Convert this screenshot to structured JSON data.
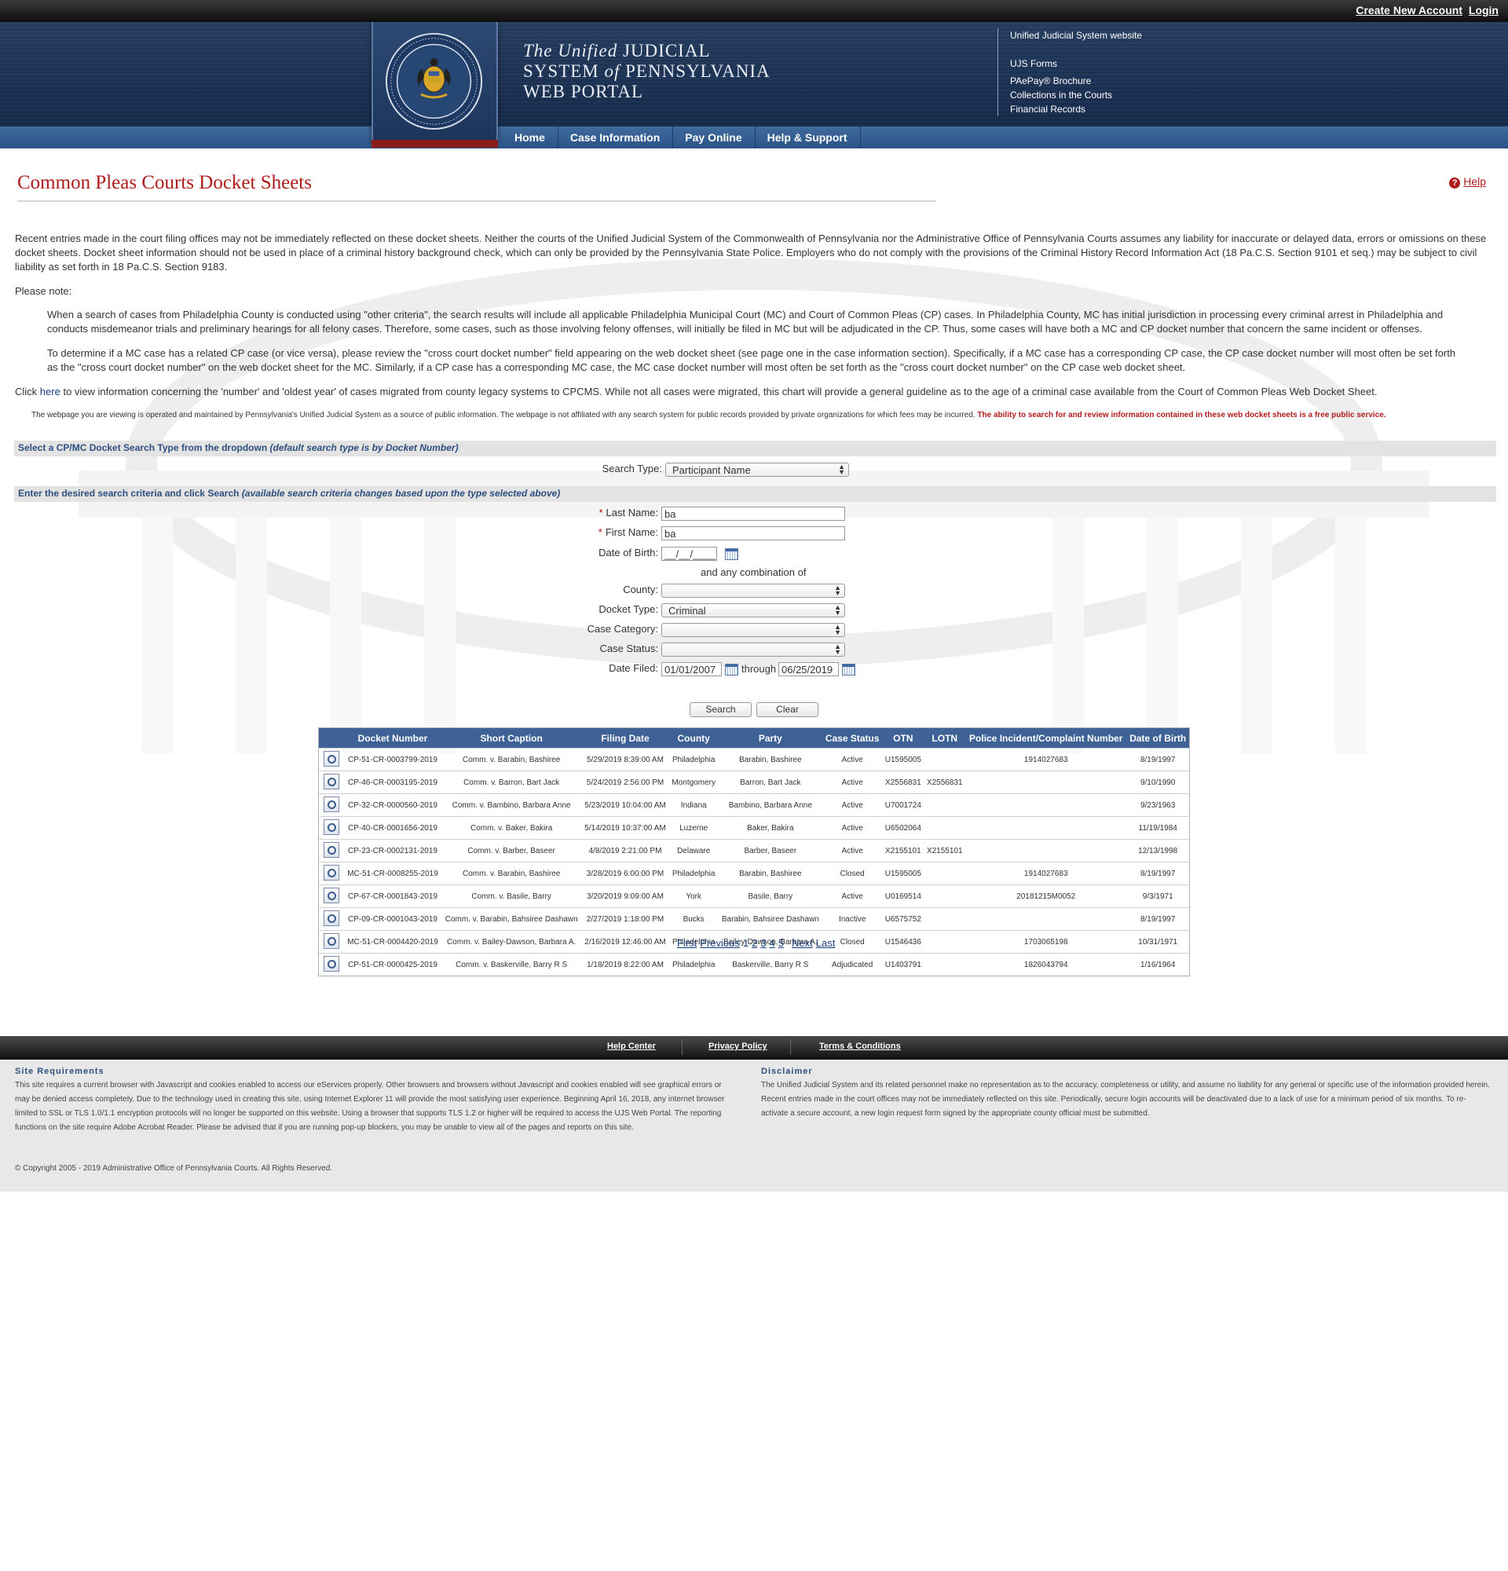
{
  "topbar": {
    "create_account": "Create New Account",
    "login": "Login"
  },
  "header": {
    "title_line1_a": "The Unified",
    "title_line1_b": "JUDICIAL",
    "title_line2_a": "SYSTEM",
    "title_line2_b": "of",
    "title_line2_c": "PENNSYLVANIA",
    "title_line3": "WEB PORTAL",
    "links": [
      "Unified Judicial System website",
      "UJS Forms",
      "PAePay® Brochure",
      "Collections in the Courts",
      "Financial Records"
    ]
  },
  "nav": [
    "Home",
    "Case Information",
    "Pay Online",
    "Help & Support"
  ],
  "page": {
    "title": "Common Pleas Courts Docket Sheets",
    "help": "Help",
    "disclaimer": "Recent entries made in the court filing offices may not be immediately reflected on these docket sheets. Neither the courts of the Unified Judicial System of the Commonwealth of Pennsylvania nor the Administrative Office of Pennsylvania Courts assumes any liability for inaccurate or delayed data, errors or omissions on these docket sheets. Docket sheet information should not be used in place of a criminal history background check, which can only be provided by the Pennsylvania State Police. Employers who do not comply with the provisions of the Criminal History Record Information Act (18 Pa.C.S. Section 9101 et seq.) may be subject to civil liability as set forth in 18 Pa.C.S. Section 9183.",
    "please_note": "Please note:",
    "note1": "When a search of cases from Philadelphia County is conducted using \"other criteria\", the search results will include all applicable Philadelphia Municipal Court (MC) and Court of Common Pleas (CP) cases. In Philadelphia County, MC has initial jurisdiction in processing every criminal arrest in Philadelphia and conducts misdemeanor trials and preliminary hearings for all felony cases. Therefore, some cases, such as those involving felony offenses, will initially be filed in MC but will be adjudicated in the CP. Thus, some cases will have both a MC and CP docket number that concern the same incident or offenses.",
    "note2": "To determine if a MC case has a related CP case (or vice versa), please review the \"cross court docket number\" field appearing on the web docket sheet (see page one in the case information section). Specifically, if a MC case has a corresponding CP case, the CP case docket number will most often be set forth as the \"cross court docket number\" on the web docket sheet for the MC. Similarly, if a CP case has a corresponding MC case, the MC case docket number will most often be set forth as the \"cross court docket number\" on the CP case web docket sheet.",
    "click_prefix": "Click",
    "click_link": "here",
    "click_suffix": "to view information concerning the 'number' and 'oldest year' of cases migrated from county legacy systems to CPCMS. While not all cases were migrated, this chart will provide a general guideline as to the age of a criminal case available from the Court of Common Pleas Web Docket Sheet.",
    "small_note": "The webpage you are viewing is operated and maintained by Pennsylvania's Unified Judicial System as a source of public information. The webpage is not affiliated with any search system for public records provided by private organizations for which fees may be incurred.",
    "small_note_red": "The ability to search for and review information contained in these web docket sheets is a free public service."
  },
  "search": {
    "section1": "Select a CP/MC Docket Search Type from the dropdown",
    "section1_note": "(default search type is by Docket Number)",
    "search_type_label": "Search Type:",
    "search_type_value": "Participant Name",
    "section2": "Enter the desired search criteria and click Search",
    "section2_note": "(available search criteria changes based upon the type selected above)",
    "last_name_label": "Last Name:",
    "last_name_value": "ba",
    "first_name_label": "First Name:",
    "first_name_value": "ba",
    "dob_label": "Date of Birth:",
    "dob_value": "__/__/____",
    "combination": "and any combination of",
    "county_label": "County:",
    "county_value": "",
    "docket_type_label": "Docket Type:",
    "docket_type_value": "Criminal",
    "case_category_label": "Case Category:",
    "case_category_value": "",
    "case_status_label": "Case Status:",
    "case_status_value": "",
    "date_filed_label": "Date Filed:",
    "date_from": "01/01/2007",
    "through": "through",
    "date_to": "06/25/2019",
    "search_btn": "Search",
    "clear_btn": "Clear"
  },
  "results": {
    "columns": [
      "",
      "Docket Number",
      "Short Caption",
      "Filing Date",
      "County",
      "Party",
      "Case Status",
      "OTN",
      "LOTN",
      "Police Incident/Complaint Number",
      "Date of Birth"
    ],
    "rows": [
      [
        "CP-51-CR-0003799-2019",
        "Comm. v. Barabin, Bashiree",
        "5/29/2019 8:39:00 AM",
        "Philadelphia",
        "Barabin, Bashiree",
        "Active",
        "U1595005",
        "",
        "1914027683",
        "8/19/1997"
      ],
      [
        "CP-46-CR-0003195-2019",
        "Comm. v. Barron, Bart Jack",
        "5/24/2019 2:56:00 PM",
        "Montgomery",
        "Barron, Bart Jack",
        "Active",
        "X2556831",
        "X2556831",
        "",
        "9/10/1990"
      ],
      [
        "CP-32-CR-0000560-2019",
        "Comm. v. Bambino, Barbara Anne",
        "5/23/2019 10:04:00 AM",
        "Indiana",
        "Bambino, Barbara Anne",
        "Active",
        "U7001724",
        "",
        "",
        "9/23/1963"
      ],
      [
        "CP-40-CR-0001656-2019",
        "Comm. v. Baker, Bakira",
        "5/14/2019 10:37:00 AM",
        "Luzerne",
        "Baker, Bakira",
        "Active",
        "U6502064",
        "",
        "",
        "11/19/1984"
      ],
      [
        "CP-23-CR-0002131-2019",
        "Comm. v. Barber, Baseer",
        "4/8/2019 2:21:00 PM",
        "Delaware",
        "Barber, Baseer",
        "Active",
        "X2155101",
        "X2155101",
        "",
        "12/13/1998"
      ],
      [
        "MC-51-CR-0008255-2019",
        "Comm. v. Barabin, Bashiree",
        "3/28/2019 6:00:00 PM",
        "Philadelphia",
        "Barabin, Bashiree",
        "Closed",
        "U1595005",
        "",
        "1914027683",
        "8/19/1997"
      ],
      [
        "CP-67-CR-0001843-2019",
        "Comm. v. Basile, Barry",
        "3/20/2019 9:09:00 AM",
        "York",
        "Basile, Barry",
        "Active",
        "U0169514",
        "",
        "20181215M0052",
        "9/3/1971"
      ],
      [
        "CP-09-CR-0001043-2019",
        "Comm. v. Barabin, Bahsiree Dashawn",
        "2/27/2019 1:18:00 PM",
        "Bucks",
        "Barabin, Bahsiree Dashawn",
        "Inactive",
        "U6575752",
        "",
        "",
        "8/19/1997"
      ],
      [
        "MC-51-CR-0004420-2019",
        "Comm. v. Bailey-Dawson, Barbara A.",
        "2/16/2019 12:46:00 AM",
        "Philadelphia",
        "Bailey-Dawson, Barbara A.",
        "Closed",
        "U1546436",
        "",
        "1703065198",
        "10/31/1971"
      ],
      [
        "CP-51-CR-0000425-2019",
        "Comm. v. Baskerville, Barry R S",
        "1/18/2019 8:22:00 AM",
        "Philadelphia",
        "Baskerville, Barry R S",
        "Adjudicated",
        "U1403791",
        "",
        "1826043794",
        "1/16/1964"
      ]
    ]
  },
  "pager": {
    "first": "First",
    "previous": "Previous",
    "pages": [
      "1",
      "2",
      "3",
      "4",
      "5"
    ],
    "next": "Next",
    "last": "Last"
  },
  "footer": {
    "links": [
      "Help Center",
      "Privacy Policy",
      "Terms & Conditions"
    ],
    "site_req_title": "Site Requirements",
    "site_req_text": "This site requires a current browser with Javascript and cookies enabled to access our eServices properly. Other browsers and browsers without Javascript and cookies enabled will see graphical errors or may be denied access completely. Due to the technology used in creating this site, using Internet Explorer 11 will provide the most satisfying user experience. Beginning April 16, 2018, any internet browser limited to SSL or TLS 1.0/1.1 encryption protocols will no longer be supported on this website. Using a browser that supports TLS 1.2 or higher will be required to access the UJS Web Portal. The reporting functions on the site require Adobe Acrobat Reader. Please be advised that if you are running pop-up blockers, you may be unable to view all of the pages and reports on this site.",
    "disclaimer_title": "Disclaimer",
    "disclaimer_text": "The Unified Judicial System and its related personnel make no representation as to the accuracy, completeness or utility, and assume no liability for any general or specific use of the information provided herein. Recent entries made in the court offices may not be immediately reflected on this site. Periodically, secure login accounts will be deactivated due to a lack of use for a minimum period of six months. To re-activate a secure account, a new login request form signed by the appropriate county official must be submitted.",
    "copyright": "© Copyright 2005 - 2019 Administrative Office of Pennsylvania Courts. All Rights Reserved."
  }
}
